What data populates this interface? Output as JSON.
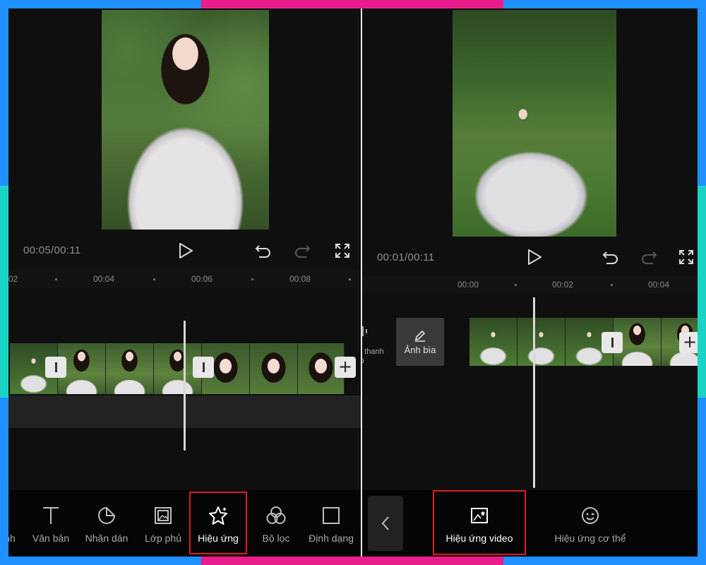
{
  "left": {
    "time": "00:05/00:11",
    "ruler": [
      "02",
      "00:04",
      "00:06",
      "00:08"
    ],
    "tools": [
      {
        "label": "nh",
        "icon": "text-icon"
      },
      {
        "label": "Văn bản",
        "icon": "text-icon"
      },
      {
        "label": "Nhãn dán",
        "icon": "sticker-icon"
      },
      {
        "label": "Lớp phủ",
        "icon": "overlay-icon"
      },
      {
        "label": "Hiệu ứng",
        "icon": "effects-star-icon"
      },
      {
        "label": "Bộ lọc",
        "icon": "filter-icon"
      },
      {
        "label": "Định dạng",
        "icon": "format-icon"
      }
    ],
    "active_tool": "Hiệu ứng"
  },
  "right": {
    "time": "00:01/00:11",
    "ruler": [
      "00:00",
      "00:02",
      "00:04"
    ],
    "mute_label": "n thanh\nip",
    "cover_label": "Ảnh bìa",
    "tools": [
      {
        "label": "Hiệu ứng video",
        "icon": "video-effects-icon"
      },
      {
        "label": "Hiệu ứng cơ thể",
        "icon": "body-effects-icon"
      }
    ],
    "active_tool": "Hiệu ứng video"
  },
  "colors": {
    "frame_blue": "#1e90ff",
    "frame_pink": "#e91e8c",
    "frame_teal": "#19d3c5",
    "highlight_red": "#e11b22"
  }
}
